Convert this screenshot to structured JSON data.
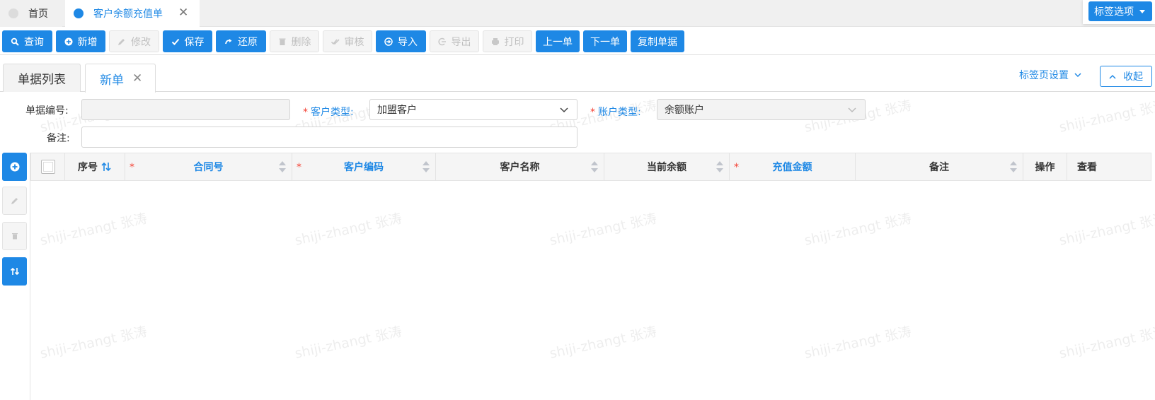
{
  "top_tabs": {
    "home_label": "首页",
    "active_label": "客户余额充值单",
    "close_glyph": "✕",
    "tag_options_label": "标签选项"
  },
  "toolbar": {
    "query": "查询",
    "add": "新增",
    "edit": "修改",
    "save": "保存",
    "restore": "还原",
    "delete": "删除",
    "audit": "审核",
    "import": "导入",
    "export": "导出",
    "print": "打印",
    "prev": "上一单",
    "next": "下一单",
    "copy": "复制单据"
  },
  "sub_tabs": {
    "list_label": "单据列表",
    "new_label": "新单",
    "close_glyph": "✕",
    "tab_settings": "标签页设置",
    "collapse": "收起"
  },
  "form": {
    "doc_no_label": "单据编号:",
    "doc_no_value": "",
    "customer_type_label": "客户类型:",
    "customer_type_value": "加盟客户",
    "account_type_label": "账户类型:",
    "account_type_value": "余额账户",
    "remark_label": "备注:",
    "remark_value": "",
    "required_mark": "*"
  },
  "table": {
    "columns": [
      "序号",
      "合同号",
      "客户编码",
      "客户名称",
      "当前余额",
      "充值金额",
      "备注",
      "操作",
      "查看"
    ],
    "rows": []
  },
  "watermark": "shiji-zhangt 张涛",
  "colors": {
    "primary": "#1e88e5",
    "required": "#f44336",
    "disabled_bg": "#f5f5f5"
  }
}
